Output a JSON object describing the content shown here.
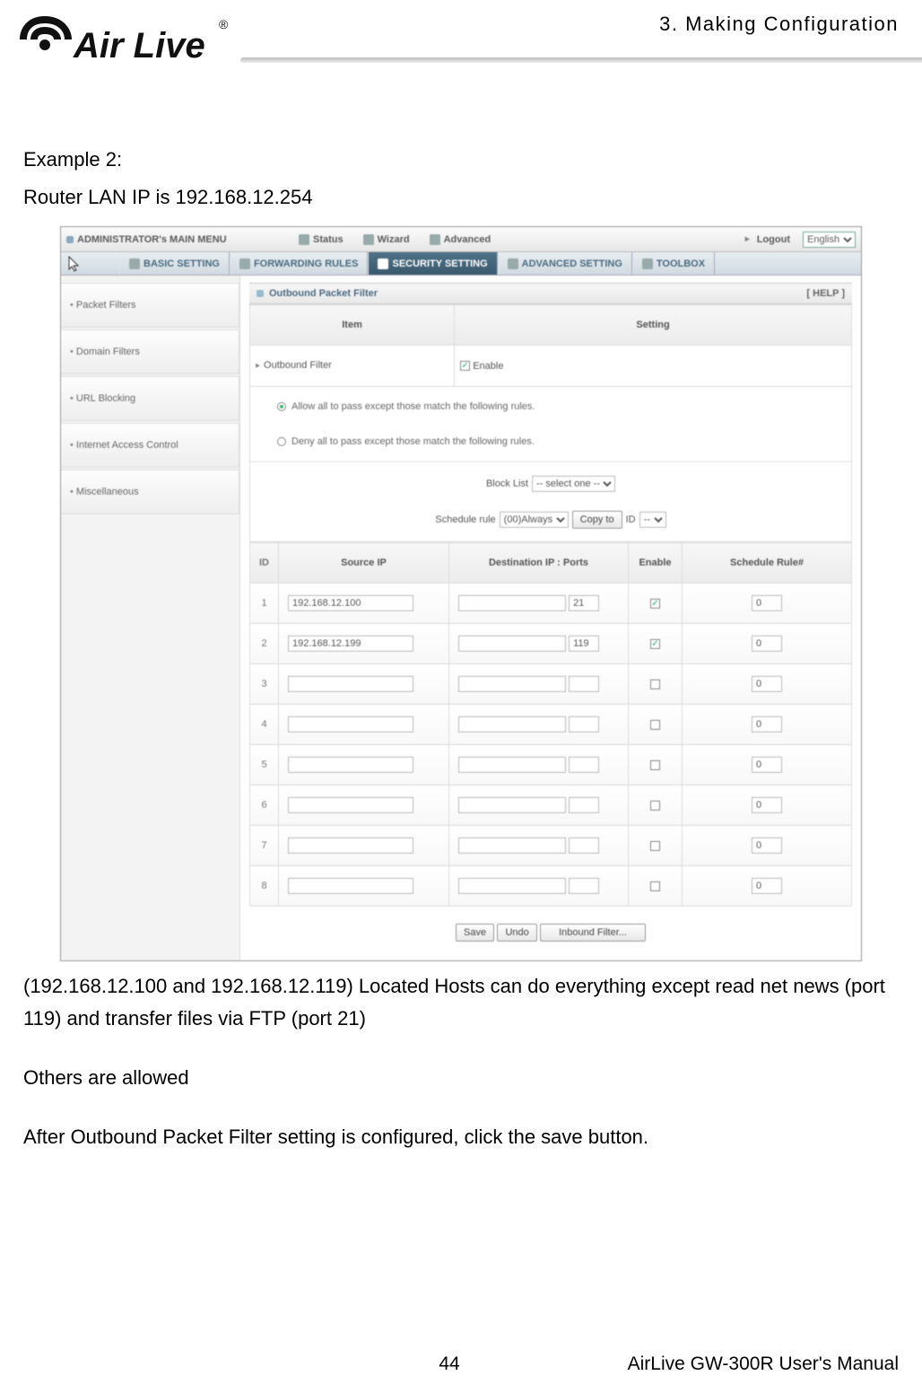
{
  "chapter_title": "3. Making Configuration",
  "brand_name": "Air Live",
  "body": {
    "example_label": "Example 2:",
    "example_desc": "Router LAN IP is 192.168.12.254",
    "after_line1": "(192.168.12.100 and 192.168.12.119) Located Hosts can do everything except read net news (port 119) and transfer files via FTP (port 21)",
    "after_line2": "Others are allowed",
    "after_line3": "After Outbound Packet Filter setting is configured, click the save button."
  },
  "shot": {
    "admin_title": "ADMINISTRATOR's MAIN MENU",
    "menu": {
      "status": "Status",
      "wizard": "Wizard",
      "advanced": "Advanced",
      "logout": "Logout"
    },
    "lang_selected": "English",
    "subtabs": {
      "basic": "BASIC SETTING",
      "forward": "FORWARDING RULES",
      "security": "SECURITY SETTING",
      "adv": "ADVANCED SETTING",
      "toolbox": "TOOLBOX"
    },
    "sidebar": [
      "Packet Filters",
      "Domain Filters",
      "URL Blocking",
      "Internet Access Control",
      "Miscellaneous"
    ],
    "panel_title": "Outbound Packet Filter",
    "help": "[ HELP ]",
    "head_item": "Item",
    "head_setting": "Setting",
    "outfilter_label": "Outbound Filter",
    "enable_label": "Enable",
    "policy_allow": "Allow all to pass except those match the following rules.",
    "policy_deny": "Deny all to pass except those match the following rules.",
    "block_list_label": "Block List",
    "block_list_sel": "-- select one --",
    "sched_rule_label": "Schedule rule",
    "sched_rule_sel": "(00)Always",
    "copy_btn": "Copy to",
    "id_label": "ID",
    "id_sel": "--",
    "cols": {
      "id": "ID",
      "src": "Source IP",
      "dst": "Destination IP : Ports",
      "en": "Enable",
      "sched": "Schedule Rule#"
    },
    "rules": [
      {
        "id": "1",
        "src": "192.168.12.100",
        "dst": "",
        "port": "21",
        "en": true,
        "rule": "0"
      },
      {
        "id": "2",
        "src": "192.168.12.199",
        "dst": "",
        "port": "119",
        "en": true,
        "rule": "0"
      },
      {
        "id": "3",
        "src": "",
        "dst": "",
        "port": "",
        "en": false,
        "rule": "0"
      },
      {
        "id": "4",
        "src": "",
        "dst": "",
        "port": "",
        "en": false,
        "rule": "0"
      },
      {
        "id": "5",
        "src": "",
        "dst": "",
        "port": "",
        "en": false,
        "rule": "0"
      },
      {
        "id": "6",
        "src": "",
        "dst": "",
        "port": "",
        "en": false,
        "rule": "0"
      },
      {
        "id": "7",
        "src": "",
        "dst": "",
        "port": "",
        "en": false,
        "rule": "0"
      },
      {
        "id": "8",
        "src": "",
        "dst": "",
        "port": "",
        "en": false,
        "rule": "0"
      }
    ],
    "btn_save": "Save",
    "btn_undo": "Undo",
    "btn_inbound": "Inbound Filter..."
  },
  "footer": {
    "page": "44",
    "manual": "AirLive GW-300R User's Manual"
  }
}
